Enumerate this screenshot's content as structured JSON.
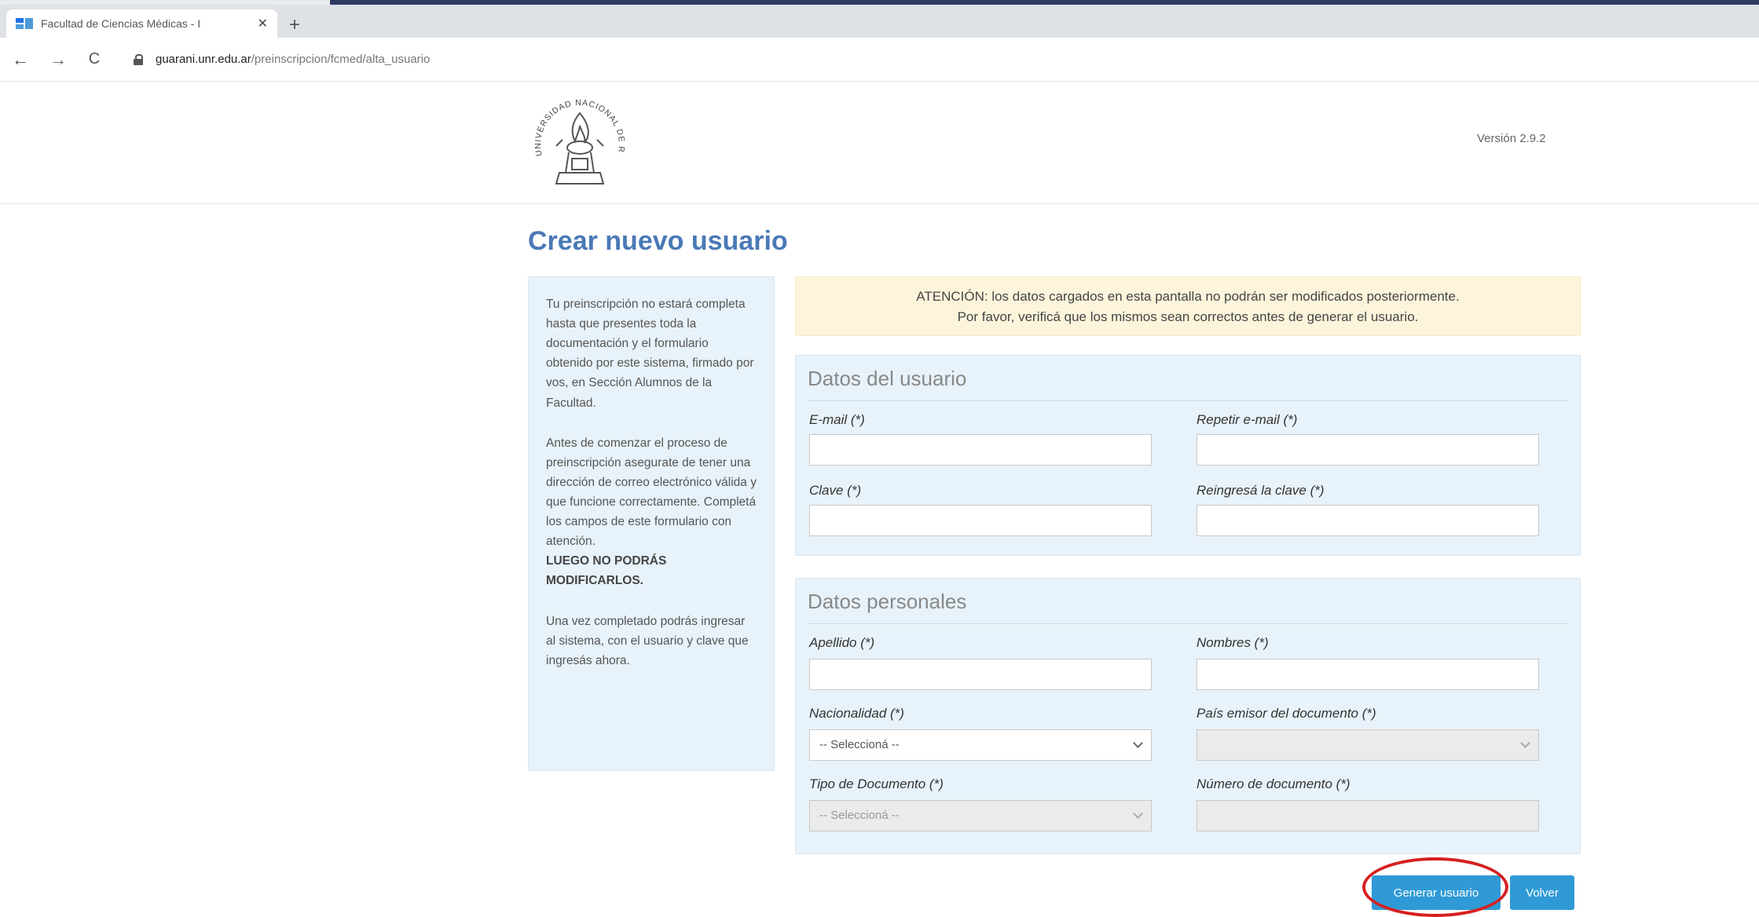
{
  "browser": {
    "tab_title": "Facultad de Ciencias Médicas - I",
    "tab_close": "✕",
    "new_tab": "+",
    "back": "←",
    "forward": "→",
    "reload": "C",
    "url_host": "guarani.unr.edu.ar",
    "url_path": "/preinscripcion/fcmed/alta_usuario"
  },
  "header": {
    "logo_text": "UNIVERSIDAD NACIONAL DE ROSARIO",
    "version": "Versión 2.9.2"
  },
  "page": {
    "title": "Crear nuevo usuario"
  },
  "info": {
    "p1": "Tu preinscripción no estará completa hasta que presentes toda la documentación y el formulario obtenido por este sistema, firmado por vos, en Sección Alumnos de la Facultad.",
    "p2": "Antes de comenzar el proceso de preinscripción asegurate de tener una dirección de correo electrónico válida y que funcione correctamente. Completá los campos de este formulario con atención.",
    "p2_bold": "LUEGO NO PODRÁS MODIFICARLOS.",
    "p3": "Una vez completado podrás ingresar al sistema, con el usuario y clave que ingresás ahora."
  },
  "alert": {
    "line1": "ATENCIÓN: los datos cargados en esta pantalla no podrán ser modificados posteriormente.",
    "line2": "Por favor, verificá que los mismos sean correctos antes de generar el usuario."
  },
  "usuario": {
    "legend": "Datos del usuario",
    "email_label": "E-mail (*)",
    "email_value": "",
    "repeat_email_label": "Repetir e-mail (*)",
    "repeat_email_value": "",
    "password_label": "Clave (*)",
    "repeat_password_label": "Reingresá la clave (*)"
  },
  "personales": {
    "legend": "Datos personales",
    "apellido_label": "Apellido (*)",
    "nombres_label": "Nombres (*)",
    "nacionalidad_label": "Nacionalidad (*)",
    "nacionalidad_value": "-- Seleccioná --",
    "pais_label": "País emisor del documento (*)",
    "pais_value": "",
    "tipo_doc_label": "Tipo de Documento (*)",
    "tipo_doc_value": "-- Seleccioná --",
    "numero_doc_label": "Número de documento (*)"
  },
  "buttons": {
    "generar": "Generar usuario",
    "volver": "Volver"
  },
  "colors": {
    "accent": "#2f9ad6",
    "title": "#4a79b6",
    "panel_bg": "#e8f2fa",
    "alert_bg": "#fcf5dc",
    "annotation": "#d62020"
  }
}
